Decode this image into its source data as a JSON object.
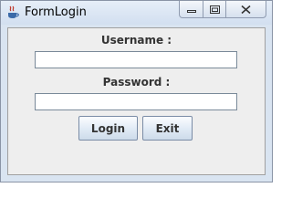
{
  "window": {
    "title": "FormLogin",
    "icon": "java-coffee-cup-icon"
  },
  "caption_buttons": {
    "minimize_icon": "minimize-icon",
    "maximize_icon": "maximize-icon",
    "close_icon": "close-icon"
  },
  "form": {
    "username_label": "Username :",
    "username_value": "",
    "password_label": "Password :",
    "password_value": "",
    "login_label": "Login",
    "exit_label": "Exit"
  },
  "colors": {
    "titlebar": "#d9e4f1",
    "client": "#eeeeee",
    "label_text": "#333333",
    "button_border": "#7a8ca6"
  }
}
